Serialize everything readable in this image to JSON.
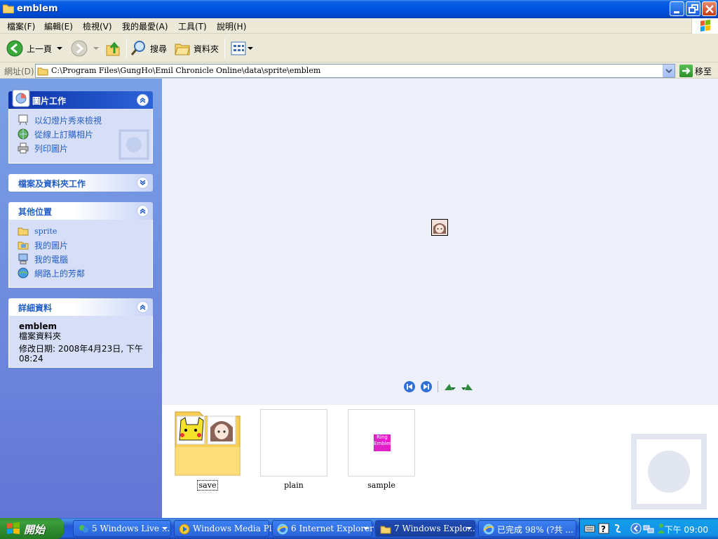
{
  "window": {
    "title": "emblem"
  },
  "menu": {
    "items": [
      "檔案(F)",
      "編輯(E)",
      "檢視(V)",
      "我的最愛(A)",
      "工具(T)",
      "說明(H)"
    ]
  },
  "toolbar": {
    "back_label": "上一頁",
    "search_label": "搜尋",
    "folders_label": "資料夾"
  },
  "address": {
    "label": "網址(D)",
    "path": "C:\\Program Files\\GungHo\\Emil Chronicle Online\\data\\sprite\\emblem",
    "go_label": "移至"
  },
  "taskpane": {
    "picture_tasks": {
      "title": "圖片工作",
      "items": [
        "以幻燈片秀來檢視",
        "從線上訂購相片",
        "列印圖片"
      ]
    },
    "file_tasks": {
      "title": "檔案及資料夾工作"
    },
    "other_places": {
      "title": "其他位置",
      "items": [
        "sprite",
        "我的圖片",
        "我的電腦",
        "網路上的芳鄰"
      ]
    },
    "details": {
      "title": "詳細資料",
      "name": "emblem",
      "type": "檔案資料夾",
      "modified_line1": "修改日期: 2008年4月23日, 下午",
      "modified_line2": "08:24"
    }
  },
  "files": [
    {
      "name": "save",
      "kind": "folder"
    },
    {
      "name": "plain",
      "kind": "image"
    },
    {
      "name": "sample",
      "kind": "image",
      "thumb_text": [
        "Ring",
        "Emblem"
      ]
    }
  ],
  "taskbar": {
    "start_label": "開始",
    "buttons": [
      "5 Windows Live ...",
      "Windows Media Pl...",
      "6 Internet Explorer",
      "7 Windows Explo...",
      "已完成 98% (?共 ..."
    ],
    "clock": "下午 09:00"
  },
  "colors": {
    "titlebar": "#0054e3",
    "taskpane_link": "#215dc6",
    "taskbar": "#2157d7",
    "start": "#3c9e3c"
  }
}
